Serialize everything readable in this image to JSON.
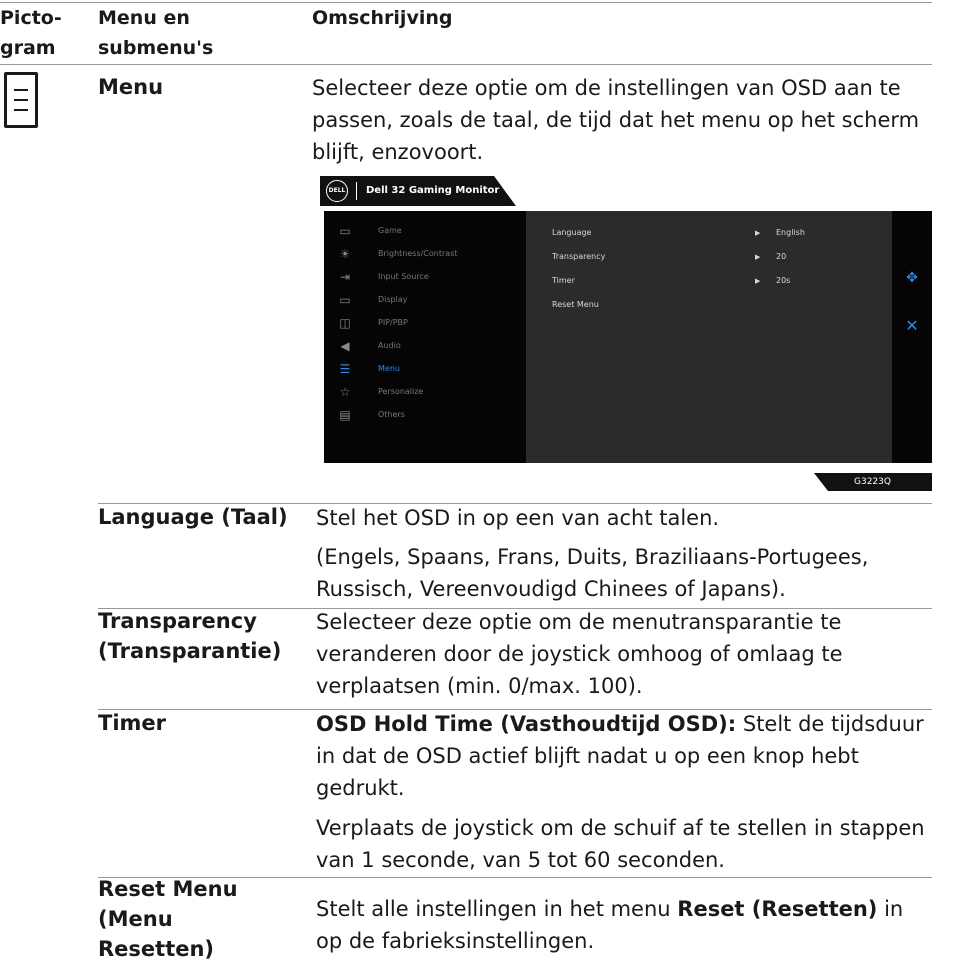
{
  "header": {
    "col1": "Picto-\ngram",
    "col2": "Menu en\nsubmenu's",
    "col3": "Omschrijving"
  },
  "menu_row": {
    "icon": "menu-list-icon",
    "name": "Menu",
    "description": "Selecteer deze optie om de instellingen van OSD aan te passen, zoals de taal, de tijd dat het menu op het scherm blijft, enzovoort."
  },
  "osd": {
    "brand": "DELL",
    "title": "Dell 32 Gaming Monitor",
    "menu_items": [
      {
        "label": "Game",
        "icon": "game-icon",
        "active": false
      },
      {
        "label": "Brightness/Contrast",
        "icon": "brightness-icon",
        "active": false
      },
      {
        "label": "Input Source",
        "icon": "input-source-icon",
        "active": false
      },
      {
        "label": "Display",
        "icon": "display-icon",
        "active": false
      },
      {
        "label": "PIP/PBP",
        "icon": "pip-pbp-icon",
        "active": false
      },
      {
        "label": "Audio",
        "icon": "audio-icon",
        "active": false
      },
      {
        "label": "Menu",
        "icon": "menu-icon",
        "active": true
      },
      {
        "label": "Personalize",
        "icon": "star-icon",
        "active": false
      },
      {
        "label": "Others",
        "icon": "others-icon",
        "active": false
      }
    ],
    "settings": [
      {
        "name": "Language",
        "value": "English"
      },
      {
        "name": "Transparency",
        "value": "20"
      },
      {
        "name": "Timer",
        "value": "20s"
      },
      {
        "name": "Reset Menu",
        "value": ""
      }
    ],
    "model": "G3223Q",
    "accent_color": "#2f86d8"
  },
  "rows": {
    "language": {
      "name": "Language (Taal)",
      "desc1": "Stel het OSD in op een van acht talen.",
      "desc2": "(Engels, Spaans, Frans, Duits, Braziliaans-Portugees, Russisch, Vereenvoudigd Chinees of Japans)."
    },
    "transparency": {
      "name": "Transparency\n(Transparantie)",
      "desc": "Selecteer deze optie om de menutransparantie te veranderen door de joystick omhoog of omlaag te verplaatsen (min. 0/max. 100)."
    },
    "timer": {
      "name": "Timer",
      "desc_bold": "OSD Hold Time (Vasthoudtijd OSD):",
      "desc_rest": " Stelt de tijdsduur in dat de OSD actief blijft nadat u op een knop hebt gedrukt.",
      "desc2": "Verplaats de joystick om de schuif af te stellen in stappen van 1 seconde, van 5 tot 60 seconden."
    },
    "reset": {
      "name": "Reset Menu\n(Menu\nResetten)",
      "desc_a": "Stelt alle instellingen in het menu ",
      "desc_bold": "Reset (Resetten)",
      "desc_b": " in op de fabrieksinstellingen."
    }
  }
}
